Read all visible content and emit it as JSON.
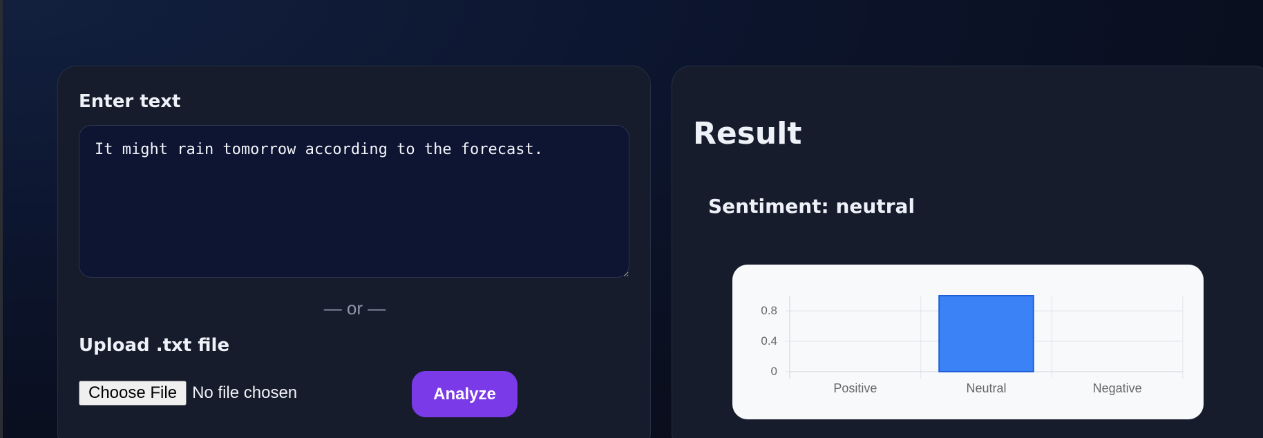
{
  "input_panel": {
    "enter_label": "Enter text",
    "text_value": "It might rain tomorrow according to the forecast.",
    "or_divider": "— or —",
    "upload_label": "Upload .txt file",
    "choose_file_label": "Choose File",
    "no_file_text": "No file chosen",
    "analyze_label": "Analyze"
  },
  "result_panel": {
    "title": "Result",
    "sentiment_text": "Sentiment: neutral"
  },
  "colors": {
    "accent": "#7a3ae8",
    "bar": "#3b82f6"
  },
  "chart_data": {
    "type": "bar",
    "categories": [
      "Positive",
      "Neutral",
      "Negative"
    ],
    "values": [
      0,
      1,
      0
    ],
    "ylim": [
      0,
      1
    ],
    "yticks": [
      "0",
      "0.4",
      "0.8"
    ],
    "ytick_values": [
      0,
      0.4,
      0.8
    ],
    "grid": true,
    "legend": "none",
    "title": "",
    "xlabel": "",
    "ylabel": ""
  }
}
